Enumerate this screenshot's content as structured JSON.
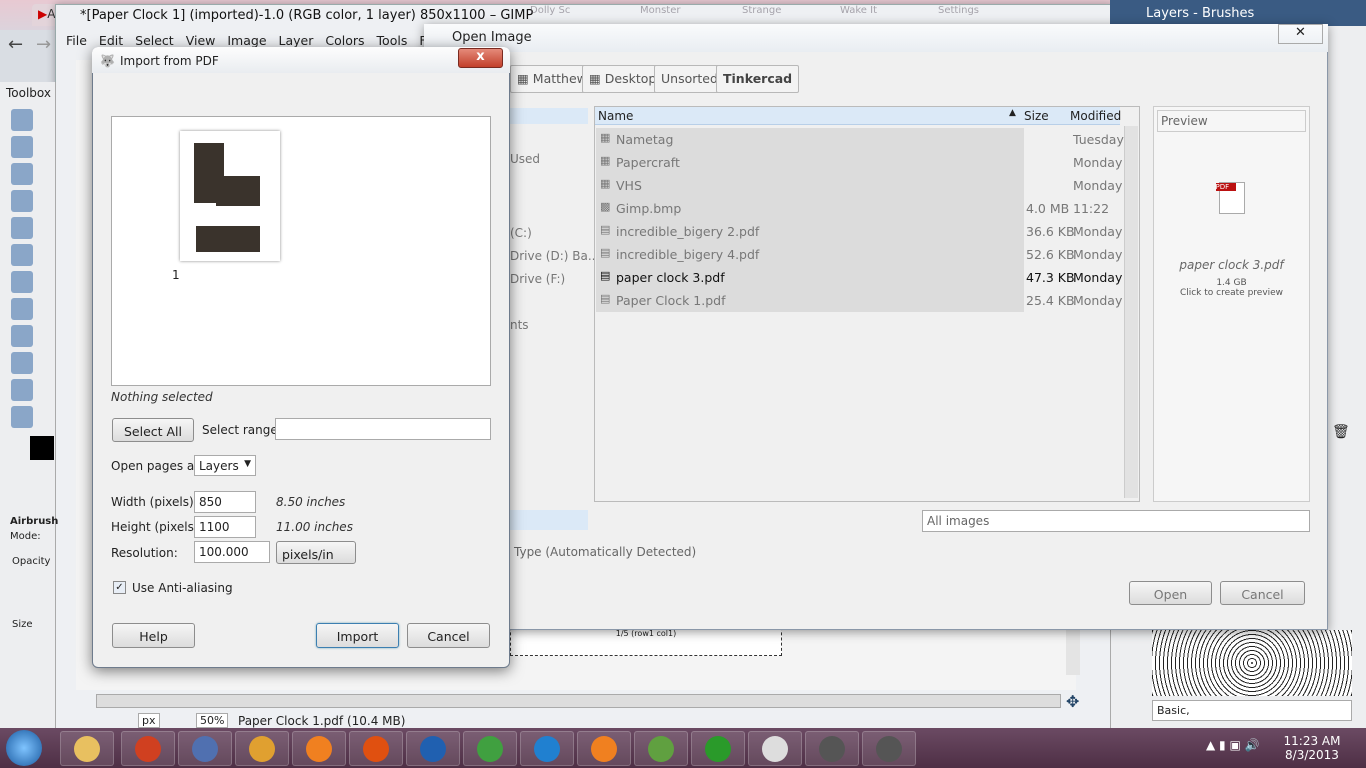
{
  "browser": {
    "tabs": [
      "Ali",
      "Dolly Sc",
      "Monster",
      "Strange",
      "Wake It",
      "Settings"
    ]
  },
  "gimp": {
    "title": "*[Paper Clock 1] (imported)-1.0 (RGB color, 1 layer) 850x1100 – GIMP",
    "menu": [
      "File",
      "Edit",
      "Select",
      "View",
      "Image",
      "Layer",
      "Colors",
      "Tools",
      "Filters"
    ],
    "status": {
      "unit": "px",
      "zoom": "50%",
      "file": "Paper Clock 1.pdf (10.4 MB)"
    },
    "canvas_label": "1/5 (row1 col1)"
  },
  "toolbox": {
    "title": "Toolbox",
    "tool_name": "Airbrush",
    "mode_label": "Mode:",
    "opacity_label": "Opacity",
    "size_label": "Size"
  },
  "right_panel": {
    "title": "Layers - Brushes",
    "brush_set": "Basic,"
  },
  "open_dialog": {
    "title": "Open Image",
    "path": [
      "Matthew",
      "Desktop",
      "Unsorted",
      "Tinkercad"
    ],
    "places": [
      "Used",
      "(C:)",
      "Drive (D:) Ba...",
      "Drive (F:)",
      "nts"
    ],
    "columns": {
      "name": "Name",
      "size": "Size",
      "modified": "Modified"
    },
    "files": [
      {
        "name": "Nametag",
        "size": "",
        "modified": "Tuesday",
        "icon": "folder-icon"
      },
      {
        "name": "Papercraft",
        "size": "",
        "modified": "Monday",
        "icon": "folder-icon"
      },
      {
        "name": "VHS",
        "size": "",
        "modified": "Monday",
        "icon": "folder-icon"
      },
      {
        "name": "Gimp.bmp",
        "size": "4.0 MB",
        "modified": "11:22",
        "icon": "image-file-icon"
      },
      {
        "name": "incredible_bigery 2.pdf",
        "size": "36.6 KB",
        "modified": "Monday",
        "icon": "pdf-file-icon"
      },
      {
        "name": "incredible_bigery 4.pdf",
        "size": "52.6 KB",
        "modified": "Monday",
        "icon": "pdf-file-icon"
      },
      {
        "name": "paper clock 3.pdf",
        "size": "47.3 KB",
        "modified": "Monday",
        "icon": "pdf-file-icon",
        "selected": true
      },
      {
        "name": "Paper Clock 1.pdf",
        "size": "25.4 KB",
        "modified": "Monday",
        "icon": "pdf-file-icon"
      }
    ],
    "preview": {
      "label": "Preview",
      "filename": "paper clock 3.pdf",
      "size": "1.4 GB",
      "hint": "Click to create preview"
    },
    "filter": "All images",
    "file_type": "Type (Automatically Detected)",
    "open": "Open",
    "cancel": "Cancel"
  },
  "pdf_dialog": {
    "title": "Import from PDF",
    "page_number": "1",
    "nothing_selected": "Nothing selected",
    "select_all": "Select All",
    "select_range_label": "Select range:",
    "select_range_value": "",
    "open_pages_label": "Open pages as",
    "open_pages_value": "Layers",
    "width_label": "Width (pixels):",
    "width_value": "850",
    "width_inches": "8.50 inches",
    "height_label": "Height (pixels):",
    "height_value": "1100",
    "height_inches": "11.00 inches",
    "resolution_label": "Resolution:",
    "resolution_value": "100.000",
    "resolution_unit": "pixels/in",
    "antialias_label": "Use Anti-aliasing",
    "antialias_checked": true,
    "help": "Help",
    "import": "Import",
    "cancel": "Cancel"
  },
  "taskbar": {
    "time": "11:23 AM",
    "date": "8/3/2013",
    "apps": [
      "explorer",
      "paint",
      "speech",
      "movie-maker",
      "media-player",
      "firefox",
      "writer",
      "chrome",
      "inkscape",
      "blender",
      "fern-app",
      "utorrent",
      "libreoffice",
      "gimp",
      "gimp"
    ]
  }
}
